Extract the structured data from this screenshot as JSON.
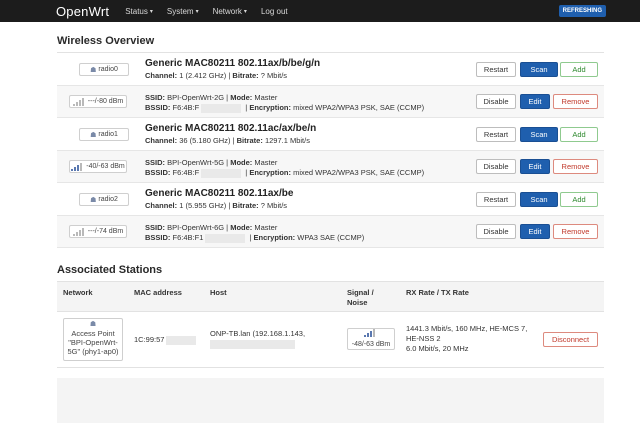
{
  "topbar": {
    "brand": "OpenWrt",
    "nav": [
      {
        "label": "Status",
        "caret": "▾"
      },
      {
        "label": "System",
        "caret": "▾"
      },
      {
        "label": "Network",
        "caret": "▾"
      },
      {
        "label": "Log out",
        "caret": ""
      }
    ],
    "badge": "REFRESHING"
  },
  "wireless": {
    "title": "Wireless Overview",
    "radios": [
      {
        "chip": "radio0",
        "title": "Generic MAC80211 802.11ax/b/be/g/n",
        "channel_label": "Channel:",
        "channel_value": "1 (2.412 GHz)",
        "bitrate_label": "Bitrate:",
        "bitrate_value": "? Mbit/s",
        "buttons": [
          "Restart",
          "Scan",
          "Add"
        ]
      },
      {
        "chip": "radio1",
        "title": "Generic MAC80211 802.11ac/ax/be/n",
        "channel_label": "Channel:",
        "channel_value": "36 (5.180 GHz)",
        "bitrate_label": "Bitrate:",
        "bitrate_value": "1297.1 Mbit/s",
        "buttons": [
          "Restart",
          "Scan",
          "Add"
        ]
      },
      {
        "chip": "radio2",
        "title": "Generic MAC80211 802.11ax/be",
        "channel_label": "Channel:",
        "channel_value": "1 (5.955 GHz)",
        "bitrate_label": "Bitrate:",
        "bitrate_value": "? Mbit/s",
        "buttons": [
          "Restart",
          "Scan",
          "Add"
        ]
      }
    ],
    "networks": [
      {
        "signal": "---/-80 dBm",
        "ssid_label": "SSID:",
        "ssid_value": "BPI-OpenWrt-2G",
        "mode_label": "Mode:",
        "mode_value": "Master",
        "bssid_label": "BSSID:",
        "bssid_value": "F6:4B:F",
        "enc_label": "Encryption:",
        "enc_value": "mixed WPA2/WPA3 PSK, SAE (CCMP)",
        "buttons": [
          "Disable",
          "Edit",
          "Remove"
        ]
      },
      {
        "signal": "-40/-63 dBm",
        "ssid_label": "SSID:",
        "ssid_value": "BPI-OpenWrt-5G",
        "mode_label": "Mode:",
        "mode_value": "Master",
        "bssid_label": "BSSID:",
        "bssid_value": "F6:4B:F",
        "enc_label": "Encryption:",
        "enc_value": "mixed WPA2/WPA3 PSK, SAE (CCMP)",
        "buttons": [
          "Disable",
          "Edit",
          "Remove"
        ]
      },
      {
        "signal": "---/-74 dBm",
        "ssid_label": "SSID:",
        "ssid_value": "BPI-OpenWrt-6G",
        "mode_label": "Mode:",
        "mode_value": "Master",
        "bssid_label": "BSSID:",
        "bssid_value": "F6:4B:F1",
        "enc_label": "Encryption:",
        "enc_value": "WPA3 SAE (CCMP)",
        "buttons": [
          "Disable",
          "Edit",
          "Remove"
        ]
      }
    ]
  },
  "stations": {
    "title": "Associated Stations",
    "headers": {
      "network": "Network",
      "mac": "MAC address",
      "host": "Host",
      "signal_1": "Signal /",
      "signal_2": "Noise",
      "rate": "RX Rate / TX Rate"
    },
    "row": {
      "ap_1": "Access Point",
      "ap_2": "\"BPI-OpenWrt-",
      "ap_3": "5G\" (phy1-ap0)",
      "mac": "1C:99:57",
      "host": "ONP-TB.lan (192.168.1.143,",
      "signal": "-48/-63 dBm",
      "rate_1": "1441.3 Mbit/s, 160 MHz, HE-MCS 7,",
      "rate_2": "HE-NSS 2",
      "rate_3": "6.0 Mbit/s, 20 MHz",
      "action": "Disconnect"
    }
  }
}
